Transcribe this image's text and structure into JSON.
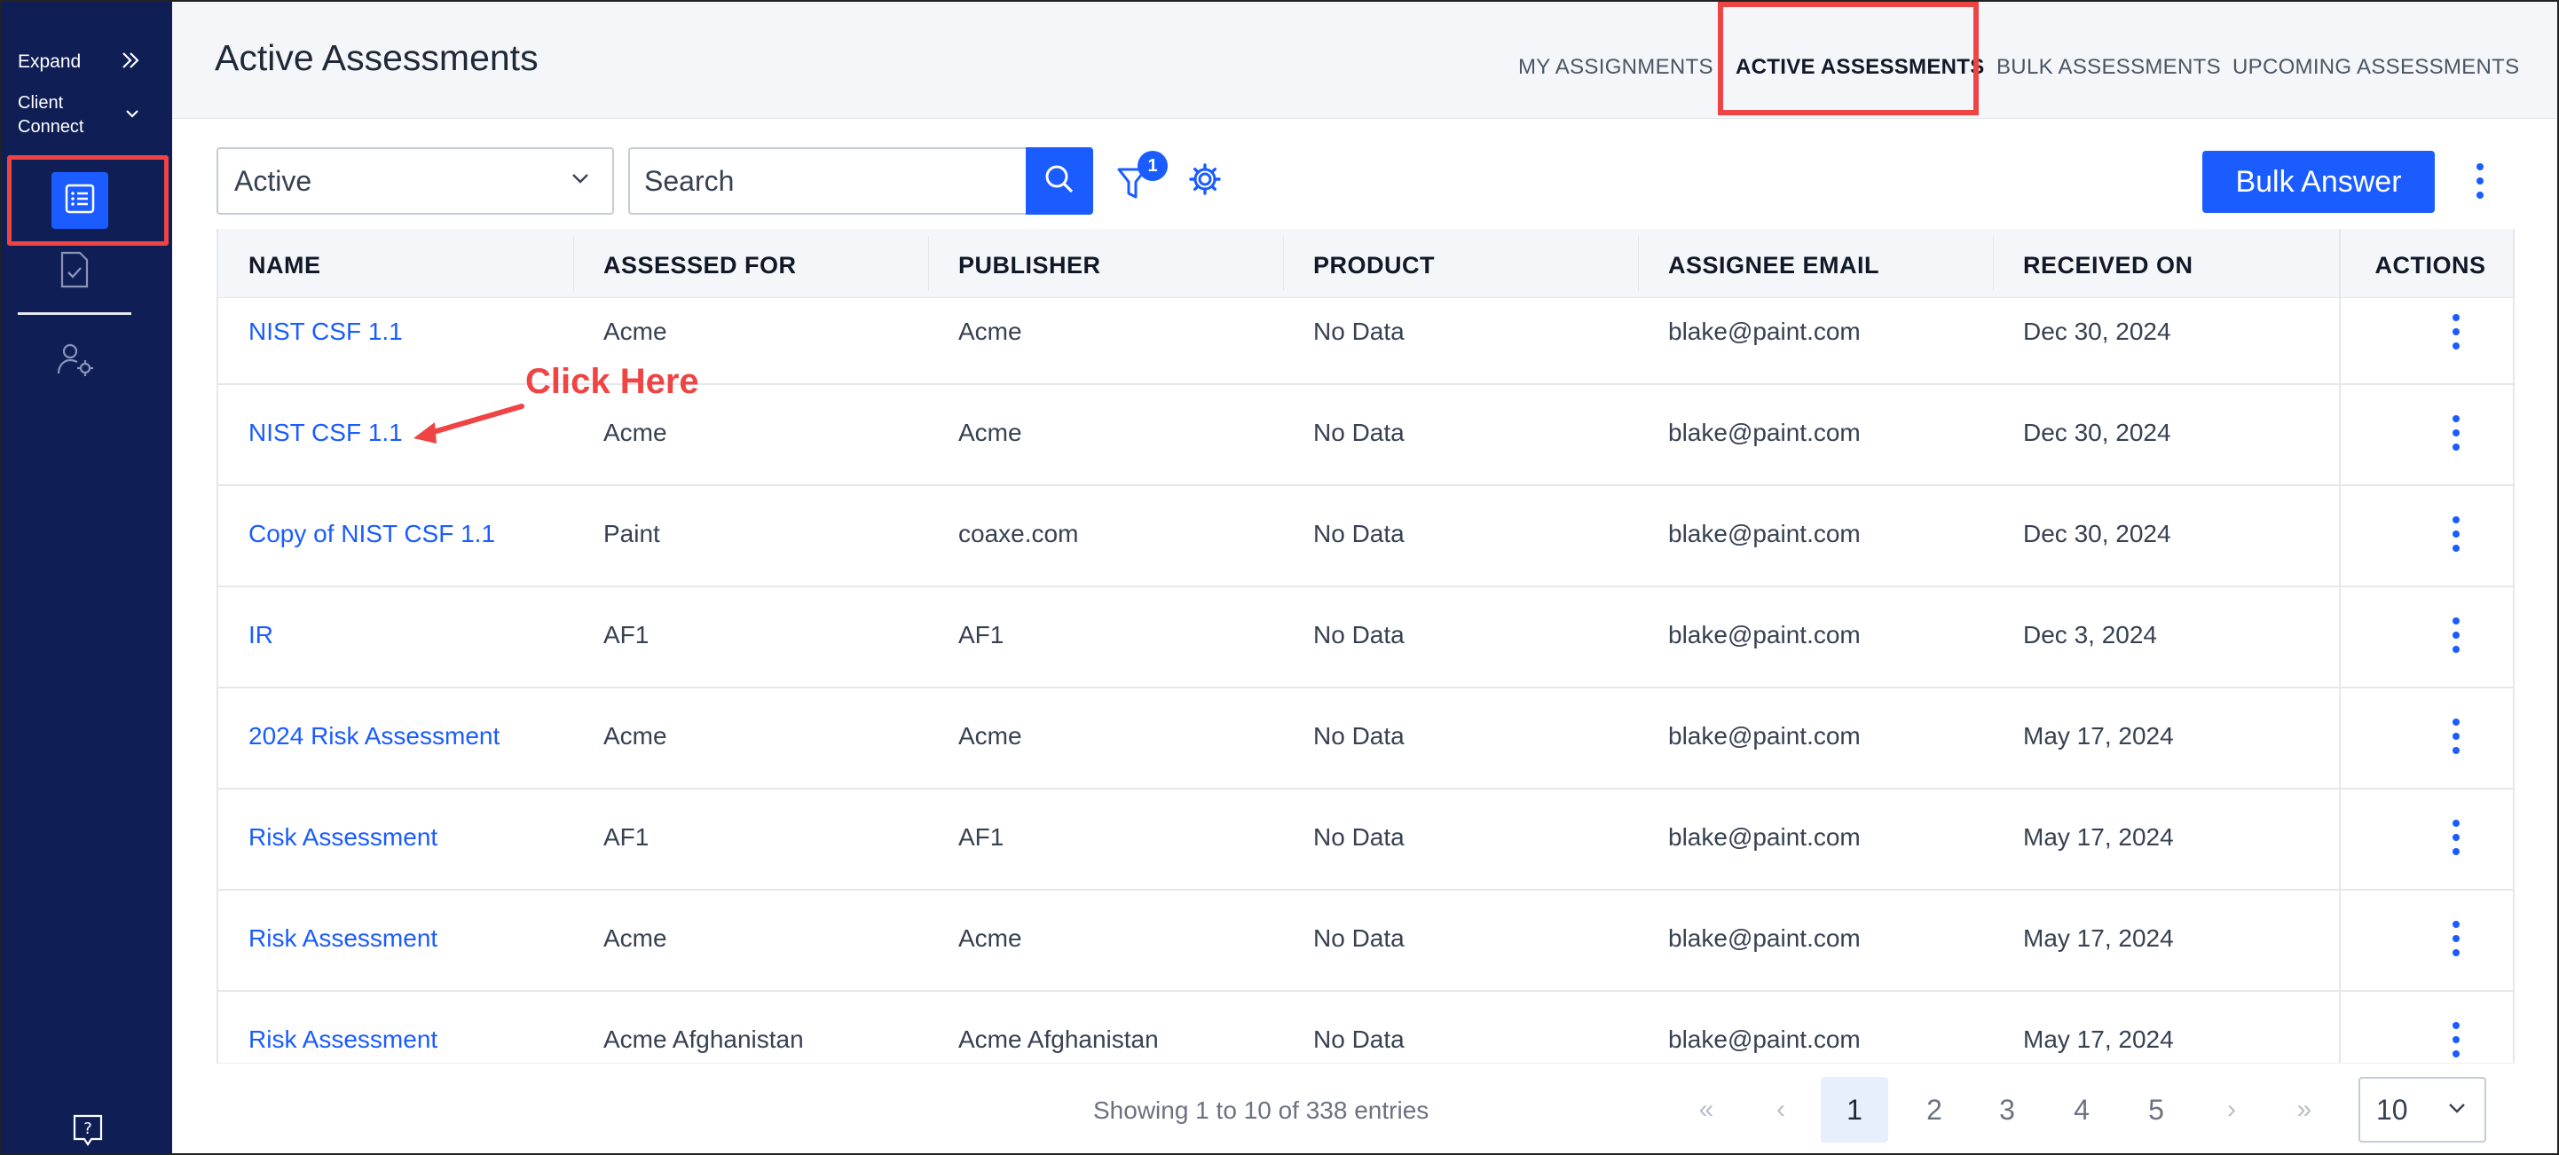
{
  "sidebar": {
    "expand_label": "Expand",
    "client_connect_label": "Client\nConnect",
    "icons": [
      "list-icon",
      "document-check-icon",
      "user-gear-icon",
      "help-icon"
    ],
    "active_color": "#1a5cff",
    "background": "#0f1f56"
  },
  "header": {
    "title": "Active Assessments",
    "tabs": [
      {
        "label": "MY ASSIGNMENTS"
      },
      {
        "label": "ACTIVE ASSESSMENTS",
        "active": true
      },
      {
        "label": "BULK ASSESSMENTS"
      },
      {
        "label": "UPCOMING ASSESSMENTS"
      }
    ]
  },
  "toolbar": {
    "status_value": "Active",
    "search_placeholder": "Search",
    "filter_count": "1",
    "bulk_answer_label": "Bulk Answer"
  },
  "table": {
    "columns": [
      "NAME",
      "ASSESSED FOR",
      "PUBLISHER",
      "PRODUCT",
      "ASSIGNEE EMAIL",
      "RECEIVED ON",
      "ACTIONS"
    ],
    "rows": [
      {
        "name": "NIST CSF 1.1",
        "assessed_for": "Acme",
        "publisher": "Acme",
        "product": "No Data",
        "email": "blake@paint.com",
        "received": "Dec 30, 2024"
      },
      {
        "name": "NIST CSF 1.1",
        "assessed_for": "Acme",
        "publisher": "Acme",
        "product": "No Data",
        "email": "blake@paint.com",
        "received": "Dec 30, 2024"
      },
      {
        "name": "Copy of NIST CSF 1.1",
        "assessed_for": "Paint",
        "publisher": "coaxe.com",
        "product": "No Data",
        "email": "blake@paint.com",
        "received": "Dec 30, 2024"
      },
      {
        "name": "IR",
        "assessed_for": "AF1",
        "publisher": "AF1",
        "product": "No Data",
        "email": "blake@paint.com",
        "received": "Dec 3, 2024"
      },
      {
        "name": "2024 Risk Assessment",
        "assessed_for": "Acme",
        "publisher": "Acme",
        "product": "No Data",
        "email": "blake@paint.com",
        "received": "May 17, 2024"
      },
      {
        "name": "Risk Assessment",
        "assessed_for": "AF1",
        "publisher": "AF1",
        "product": "No Data",
        "email": "blake@paint.com",
        "received": "May 17, 2024"
      },
      {
        "name": "Risk Assessment",
        "assessed_for": "Acme",
        "publisher": "Acme",
        "product": "No Data",
        "email": "blake@paint.com",
        "received": "May 17, 2024"
      },
      {
        "name": "Risk Assessment",
        "assessed_for": "Acme Afghanistan",
        "publisher": "Acme Afghanistan",
        "product": "No Data",
        "email": "blake@paint.com",
        "received": "May 17, 2024"
      }
    ]
  },
  "annotation": {
    "text": "Click Here",
    "color": "#ef4444"
  },
  "pagination": {
    "entries_text": "Showing 1 to 10 of 338 entries",
    "pages": [
      "1",
      "2",
      "3",
      "4",
      "5"
    ],
    "current_page": "1",
    "first": "«",
    "prev": "‹",
    "next": "›",
    "last": "»",
    "page_size": "10"
  }
}
